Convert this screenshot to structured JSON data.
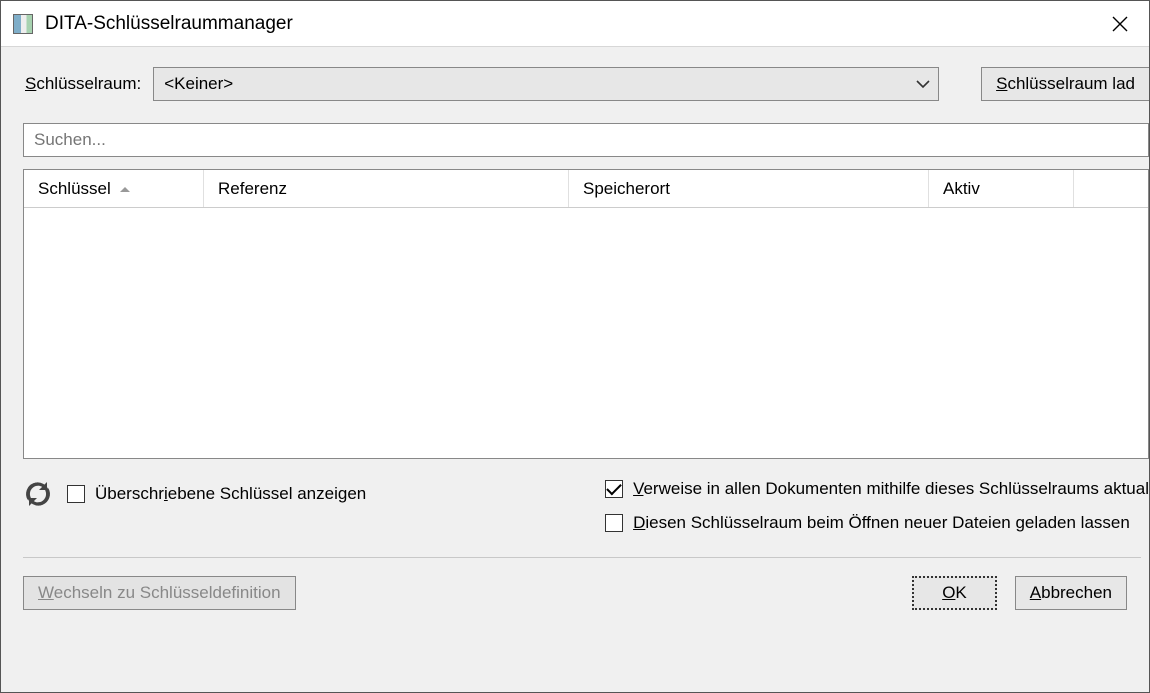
{
  "window": {
    "title": "DITA-Schlüsselraummanager"
  },
  "keyspace": {
    "label_pre": "S",
    "label_rest": "chlüsselraum:",
    "value": "<Keiner>",
    "load_button_pre": "S",
    "load_button_rest": "chlüsselraum lad"
  },
  "search": {
    "placeholder": "Suchen..."
  },
  "table": {
    "columns": [
      "Schlüssel",
      "Referenz",
      "Speicherort",
      "Aktiv"
    ],
    "sorted_col": 0,
    "rows": []
  },
  "options": {
    "show_overridden_pre": "Überschr",
    "show_overridden_u": "i",
    "show_overridden_post": "ebene Schlüssel anzeigen",
    "show_overridden_checked": false,
    "update_refs_u": "V",
    "update_refs_rest": "erweise in allen Dokumenten mithilfe dieses Schlüsselraums aktual",
    "update_refs_checked": true,
    "keep_loaded_u": "D",
    "keep_loaded_rest": "iesen Schlüsselraum beim Öffnen neuer Dateien geladen lassen",
    "keep_loaded_checked": false
  },
  "footer": {
    "goto_def_u": "W",
    "goto_def_rest": "echseln zu Schlüsseldefinition",
    "ok_u": "O",
    "ok_rest": "K",
    "cancel_u": "A",
    "cancel_rest": "bbrechen"
  }
}
